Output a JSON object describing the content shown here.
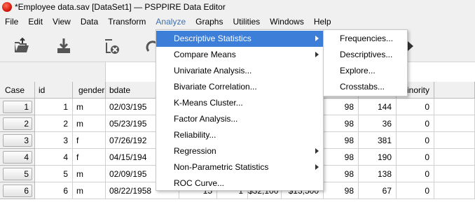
{
  "window": {
    "title": "*Employee data.sav [DataSet1] — PSPPIRE Data Editor"
  },
  "menubar": [
    "File",
    "Edit",
    "View",
    "Data",
    "Transform",
    "Analyze",
    "Graphs",
    "Utilities",
    "Windows",
    "Help"
  ],
  "toolbar": {
    "icons": [
      "open-file-icon",
      "save-icon",
      "delete-case-icon",
      "redo-icon",
      "play-icon"
    ]
  },
  "grid": {
    "headers": [
      "Case",
      "id",
      "gender",
      "bdate",
      "",
      "",
      "",
      "",
      "minority"
    ],
    "rows": [
      {
        "case": "1",
        "id": "1",
        "gender": "m",
        "bdate": "02/03/195",
        "v5": "98",
        "v6": "144",
        "minority": "0"
      },
      {
        "case": "2",
        "id": "2",
        "gender": "m",
        "bdate": "05/23/195",
        "v5": "98",
        "v6": "36",
        "minority": "0"
      },
      {
        "case": "3",
        "id": "3",
        "gender": "f",
        "bdate": "07/26/192",
        "v5": "98",
        "v6": "381",
        "minority": "0"
      },
      {
        "case": "4",
        "id": "4",
        "gender": "f",
        "bdate": "04/15/194",
        "v5": "98",
        "v6": "190",
        "minority": "0"
      },
      {
        "case": "5",
        "id": "5",
        "gender": "m",
        "bdate": "02/09/195",
        "v5": "98",
        "v6": "138",
        "minority": "0"
      },
      {
        "case": "6",
        "id": "6",
        "gender": "m",
        "bdate": "08/22/1958",
        "c1": "15",
        "c2": "1",
        "c3": "$32,100",
        "c4": "$13,500",
        "v5": "98",
        "v6": "67",
        "minority": "0"
      }
    ]
  },
  "analyze_menu": {
    "items": [
      {
        "label": "Descriptive Statistics",
        "submenu": true,
        "highlighted": true
      },
      {
        "label": "Compare Means",
        "submenu": true
      },
      {
        "label": "Univariate Analysis..."
      },
      {
        "label": "Bivariate Correlation..."
      },
      {
        "label": "K-Means Cluster..."
      },
      {
        "label": "Factor Analysis..."
      },
      {
        "label": "Reliability..."
      },
      {
        "label": "Regression",
        "submenu": true
      },
      {
        "label": "Non-Parametric Statistics",
        "submenu": true
      },
      {
        "label": "ROC Curve..."
      }
    ]
  },
  "descriptive_submenu": {
    "items": [
      "Frequencies...",
      "Descriptives...",
      "Explore...",
      "Crosstabs..."
    ]
  },
  "colors": {
    "highlight": "#3d7ed8",
    "active_menu_text": "#3a6fb4"
  }
}
